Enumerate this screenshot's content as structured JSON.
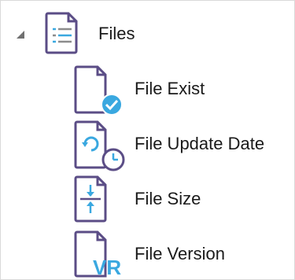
{
  "tree": {
    "root": {
      "label": "Files",
      "icon": "file-list-icon",
      "expanded": true,
      "children": [
        {
          "label": "File Exist",
          "icon": "file-check-icon"
        },
        {
          "label": "File Update Date",
          "icon": "file-clock-icon"
        },
        {
          "label": "File Size",
          "icon": "file-size-icon"
        },
        {
          "label": "File Version",
          "icon": "file-version-icon",
          "badge": "VR"
        }
      ]
    }
  },
  "colors": {
    "outline": "#5b4d86",
    "accent_blue": "#3aa8e0",
    "tree_arrow": "#707070"
  }
}
